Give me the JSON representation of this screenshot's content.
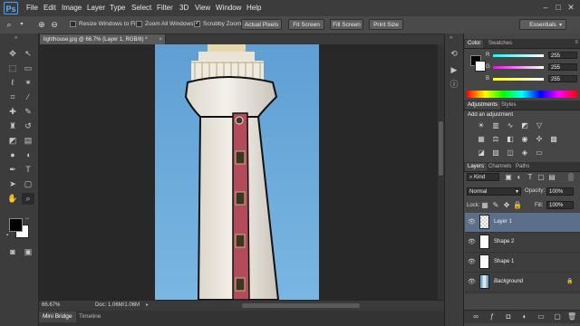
{
  "app": {
    "logo_text": "Ps"
  },
  "menu": [
    "File",
    "Edit",
    "Image",
    "Layer",
    "Type",
    "Select",
    "Filter",
    "3D",
    "View",
    "Window",
    "Help"
  ],
  "window_controls": [
    "–",
    "□",
    "✕"
  ],
  "options": {
    "resize_label": "Resize Windows to Fit",
    "zoom_all_label": "Zoom All Windows",
    "scrubby_label": "Scrubby Zoom",
    "scrubby_checked": true,
    "buttons": [
      "Actual Pixels",
      "Fit Screen",
      "Fill Screen",
      "Print Size"
    ],
    "workspace": "Essentials"
  },
  "document": {
    "tab_title": "lighthouse.jpg @ 66.7% (Layer 1, RGB/8) *",
    "zoom": "66.67%",
    "doc_info": "Doc: 1.06M/1.06M"
  },
  "bottom_tabs": [
    "Mini Bridge",
    "Timeline"
  ],
  "color_panel": {
    "tabs": [
      "Color",
      "Swatches"
    ],
    "channels": [
      {
        "label": "R",
        "value": "255"
      },
      {
        "label": "G",
        "value": "255"
      },
      {
        "label": "B",
        "value": "255"
      }
    ],
    "foreground": "#000000",
    "background": "#ffffff"
  },
  "adjustments_panel": {
    "tabs": [
      "Adjustments",
      "Styles"
    ],
    "heading": "Add an adjustment"
  },
  "layers_panel": {
    "tabs": [
      "Layers",
      "Channels",
      "Paths"
    ],
    "kind_filter": "Kind",
    "blend_mode": "Normal",
    "opacity_label": "Opacity:",
    "opacity_value": "100%",
    "lock_label": "Lock:",
    "fill_label": "Fill:",
    "fill_value": "100%",
    "layers": [
      {
        "name": "Layer 1",
        "selected": true
      },
      {
        "name": "Shape 2",
        "selected": false
      },
      {
        "name": "Shape 1",
        "selected": false
      },
      {
        "name": "Background",
        "selected": false,
        "locked": true
      }
    ]
  },
  "colors": {
    "accent": "#5c6f8a",
    "sky": "#6aa9d8",
    "stripe": "#b24b5a"
  }
}
